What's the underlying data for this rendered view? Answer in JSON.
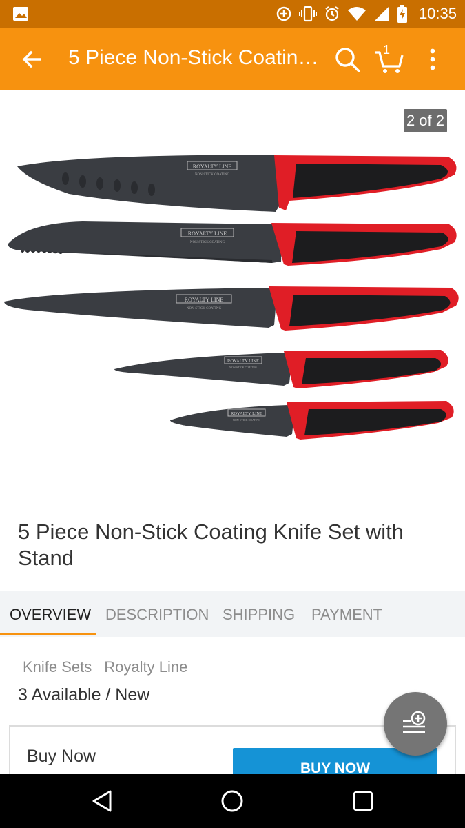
{
  "status_bar": {
    "time": "10:35",
    "icons": [
      "image-icon",
      "data-saver-icon",
      "vibrate-icon",
      "alarm-icon",
      "wifi-icon",
      "signal-icon",
      "battery-charging-icon"
    ]
  },
  "app_bar": {
    "title": "5 Piece Non-Stick Coating Knife Set with Stand",
    "cart_count": "1",
    "icons": [
      "back-arrow-icon",
      "search-icon",
      "cart-icon",
      "more-vert-icon"
    ]
  },
  "gallery": {
    "counter": "2 of 2",
    "knife_brand": "ROYALTY LINE",
    "knife_subtext": "NON-STICK COATING",
    "colors": {
      "blade": "#3a3d42",
      "handle_red": "#e01e26",
      "handle_black": "#1c1c1e"
    }
  },
  "product": {
    "title": "5 Piece Non-Stick Coating Knife Set with Stand"
  },
  "tabs": [
    {
      "label": "OVERVIEW",
      "active": true
    },
    {
      "label": "DESCRIPTION",
      "active": false
    },
    {
      "label": "SHIPPING",
      "active": false
    },
    {
      "label": "PAYMENT",
      "active": false
    }
  ],
  "overview": {
    "tags": [
      "Knife Sets",
      "Royalty Line"
    ],
    "availability": "3 Available / New"
  },
  "buy": {
    "label": "Buy Now",
    "button_label": "BUY NOW"
  },
  "fab": {
    "icon": "add-to-list-icon"
  },
  "nav_bar": {
    "icons": [
      "back-triangle-icon",
      "home-circle-icon",
      "recents-square-icon"
    ]
  },
  "theme": {
    "accent": "#f7920f",
    "status_bar": "#c96f00",
    "button_blue": "#1593d6"
  }
}
